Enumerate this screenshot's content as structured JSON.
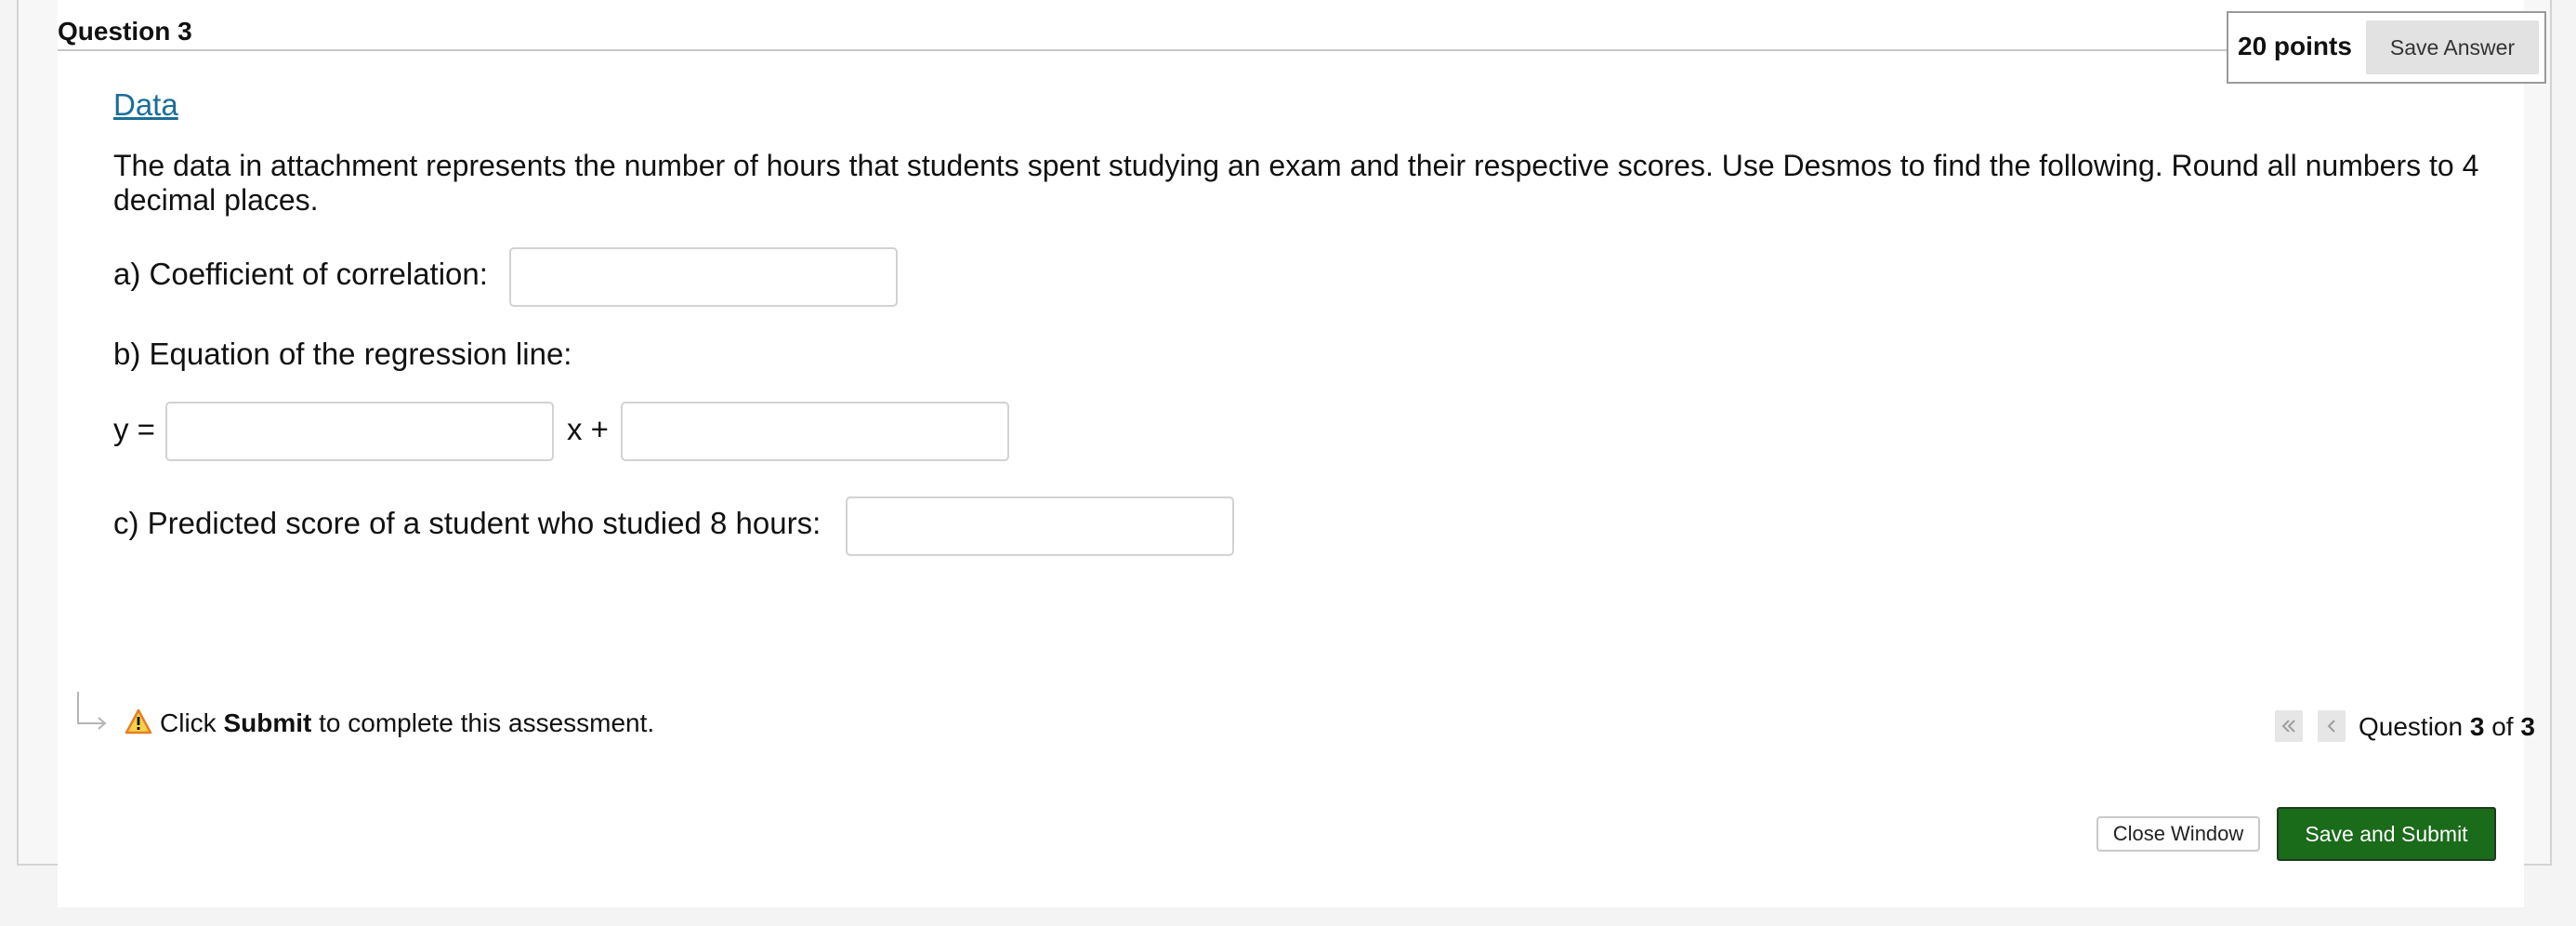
{
  "question": {
    "title": "Question 3",
    "points": "20 points",
    "save_answer_label": "Save Answer",
    "data_link": "Data",
    "prompt": "The data in attachment represents the number of hours that students spent studying an exam and their respective scores. Use Desmos to find the following. Round all numbers to 4 decimal places.",
    "part_a_label": "a) Coefficient of correlation:",
    "part_a_value": "",
    "part_b_label": "b) Equation of the regression line:",
    "y_equals": "y =",
    "x_plus": "x +",
    "slope_value": "",
    "intercept_value": "",
    "part_c_label": "c) Predicted score of a student who studied 8 hours:",
    "part_c_value": ""
  },
  "footer": {
    "hint_prefix": "Click ",
    "hint_bold": "Submit",
    "hint_suffix": " to complete this assessment.",
    "position_prefix": "Question ",
    "position_current": "3",
    "position_sep": " of ",
    "position_total": "3",
    "close_window_label": "Close Window",
    "submit_label": "Save and Submit"
  },
  "colors": {
    "link": "#1b6d9a",
    "submit_bg": "#1a6b1a",
    "warning": "#f39c12"
  },
  "icons": {
    "elbow": "elbow-arrow-icon",
    "warning": "warning-icon",
    "first": "double-chevron-left-icon",
    "previous": "chevron-left-icon"
  }
}
